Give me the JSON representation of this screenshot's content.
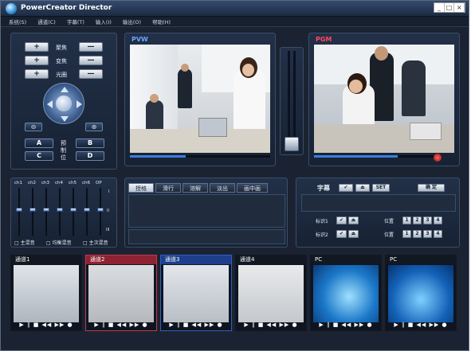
{
  "window": {
    "title": "PowerCreator Director",
    "controls": [
      "_",
      "□",
      "×"
    ]
  },
  "menu": [
    "系统(S)",
    "通道(C)",
    "字幕(T)",
    "输入(I)",
    "输出(O)",
    "帮助(H)"
  ],
  "camera": {
    "focus": "聚焦",
    "zoom": "变焦",
    "iris": "光圈",
    "plus": "+",
    "minus": "—",
    "preset": "预制位",
    "zoom_in": "⊕",
    "zoom_out": "⊖",
    "presets": [
      "A",
      "B",
      "C",
      "D"
    ]
  },
  "monitors": {
    "pvw": "PVW",
    "pgm": "PGM"
  },
  "audio": {
    "channels": [
      "ch1",
      "ch2",
      "ch3",
      "ch4",
      "ch5",
      "ch6",
      "OP"
    ],
    "levels": [
      0.55,
      0.55,
      0.55,
      0.55,
      0.55,
      0.55,
      0.55
    ],
    "scale": [
      "I",
      "II",
      "III"
    ],
    "options": [
      "主混音",
      "均衡混音",
      "主次混音"
    ]
  },
  "transitions": {
    "tabs": [
      "授格",
      "滑行",
      "溶解",
      "淡出",
      "画中画"
    ],
    "active": 0
  },
  "subtitle": {
    "title": "字幕",
    "check": "✔",
    "eject": "⏏",
    "set": "SET",
    "confirm": "确 定",
    "mark1": "标识1",
    "mark2": "标识2",
    "position": "位置",
    "positions": [
      "1",
      "2",
      "3",
      "4"
    ]
  },
  "channels": [
    {
      "name": "通道1",
      "border": "#111822",
      "title_bg": "#111822"
    },
    {
      "name": "通道2",
      "border": "#c0394b",
      "title_bg": "#8e2232"
    },
    {
      "name": "通道3",
      "border": "#2f5fc0",
      "title_bg": "#1d3f8c"
    },
    {
      "name": "通道4",
      "border": "#111822",
      "title_bg": "#111822"
    },
    {
      "name": "PC",
      "border": "#111822",
      "title_bg": "#111822"
    },
    {
      "name": "PC",
      "border": "#111822",
      "title_bg": "#111822"
    }
  ],
  "thumb_controls": "▶ ∥ ■ ◀◀ ▶▶ ●"
}
